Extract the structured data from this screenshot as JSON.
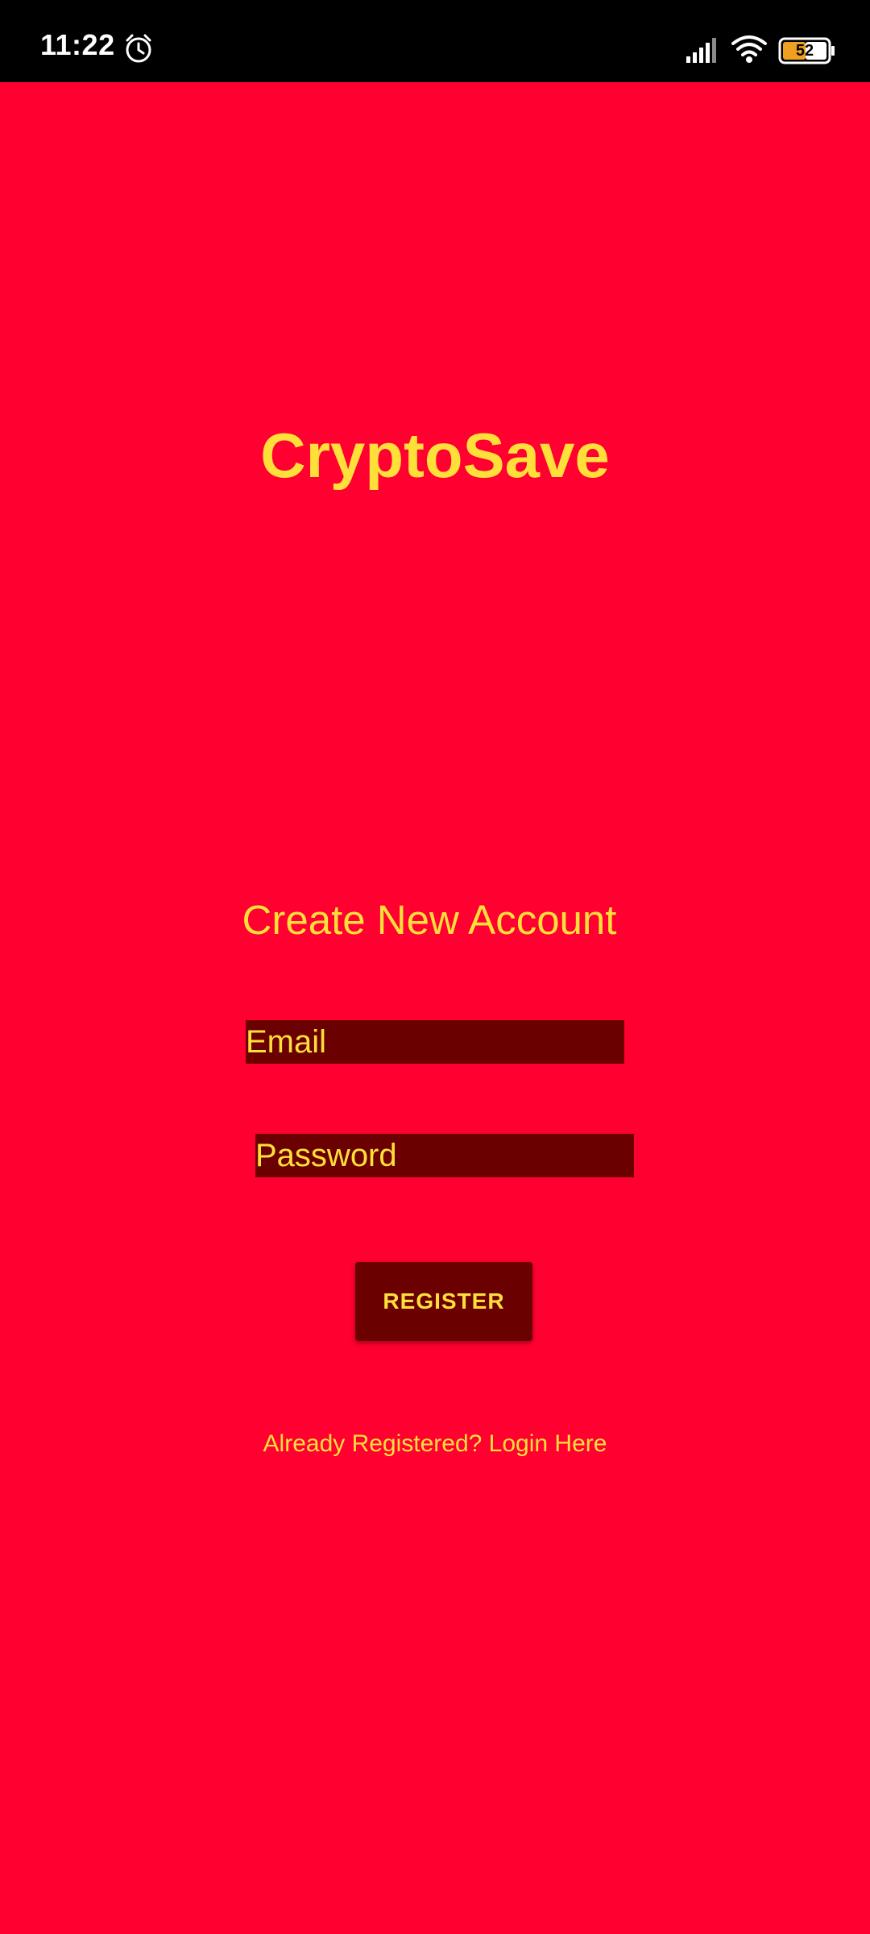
{
  "status_bar": {
    "time": "11:22",
    "battery_level": "52",
    "icons": [
      "alarm-icon",
      "signal-icon",
      "wifi-icon",
      "battery-icon"
    ]
  },
  "app": {
    "title": "CryptoSave"
  },
  "form": {
    "heading": "Create New Account",
    "email_placeholder": "Email",
    "password_placeholder": "Password",
    "register_label": "REGISTER",
    "login_link": "Already Registered? Login Here"
  },
  "colors": {
    "background": "#ff0030",
    "accent_text": "#ffe03a",
    "field_background": "#6b0000",
    "status_bar": "#000000"
  }
}
